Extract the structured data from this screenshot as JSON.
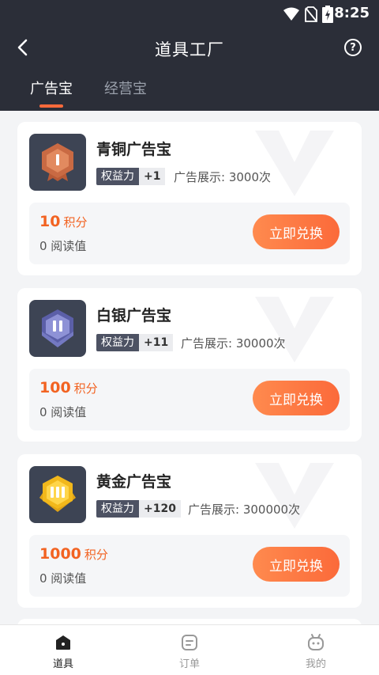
{
  "status_bar": {
    "time": "8:25",
    "icons": [
      "wifi-icon",
      "no-sim-icon",
      "battery-charging-icon"
    ]
  },
  "header": {
    "title": "道具工厂",
    "back_icon": "back-chevron-icon",
    "help_icon": "help-circle-icon",
    "help_glyph": "?"
  },
  "tabs": [
    {
      "label": "广告宝",
      "active": true
    },
    {
      "label": "经营宝",
      "active": false
    }
  ],
  "cards": [
    {
      "title": "青铜广告宝",
      "benefit_label": "权益力",
      "benefit_value": "+1",
      "ad_display": "广告展示: 3000次",
      "points": "10",
      "points_unit": "积分",
      "read_value": "0 阅读值",
      "button": "立即兑换",
      "badge_icon": "bronze-badge-icon"
    },
    {
      "title": "白银广告宝",
      "benefit_label": "权益力",
      "benefit_value": "+11",
      "ad_display": "广告展示: 30000次",
      "points": "100",
      "points_unit": "积分",
      "read_value": "0 阅读值",
      "button": "立即兑换",
      "badge_icon": "silver-badge-icon"
    },
    {
      "title": "黄金广告宝",
      "benefit_label": "权益力",
      "benefit_value": "+120",
      "ad_display": "广告展示: 300000次",
      "points": "1000",
      "points_unit": "积分",
      "read_value": "0 阅读值",
      "button": "立即兑换",
      "badge_icon": "gold-badge-icon"
    }
  ],
  "bottom_nav": [
    {
      "label": "道具",
      "icon": "tools-home-icon",
      "active": true
    },
    {
      "label": "订单",
      "icon": "orders-icon",
      "active": false
    },
    {
      "label": "我的",
      "icon": "profile-robot-icon",
      "active": false
    }
  ],
  "colors": {
    "header_bg": "#2b2e38",
    "accent": "#f26322",
    "button_gradient_start": "#ff8a4e",
    "button_gradient_end": "#fb6a3a"
  }
}
